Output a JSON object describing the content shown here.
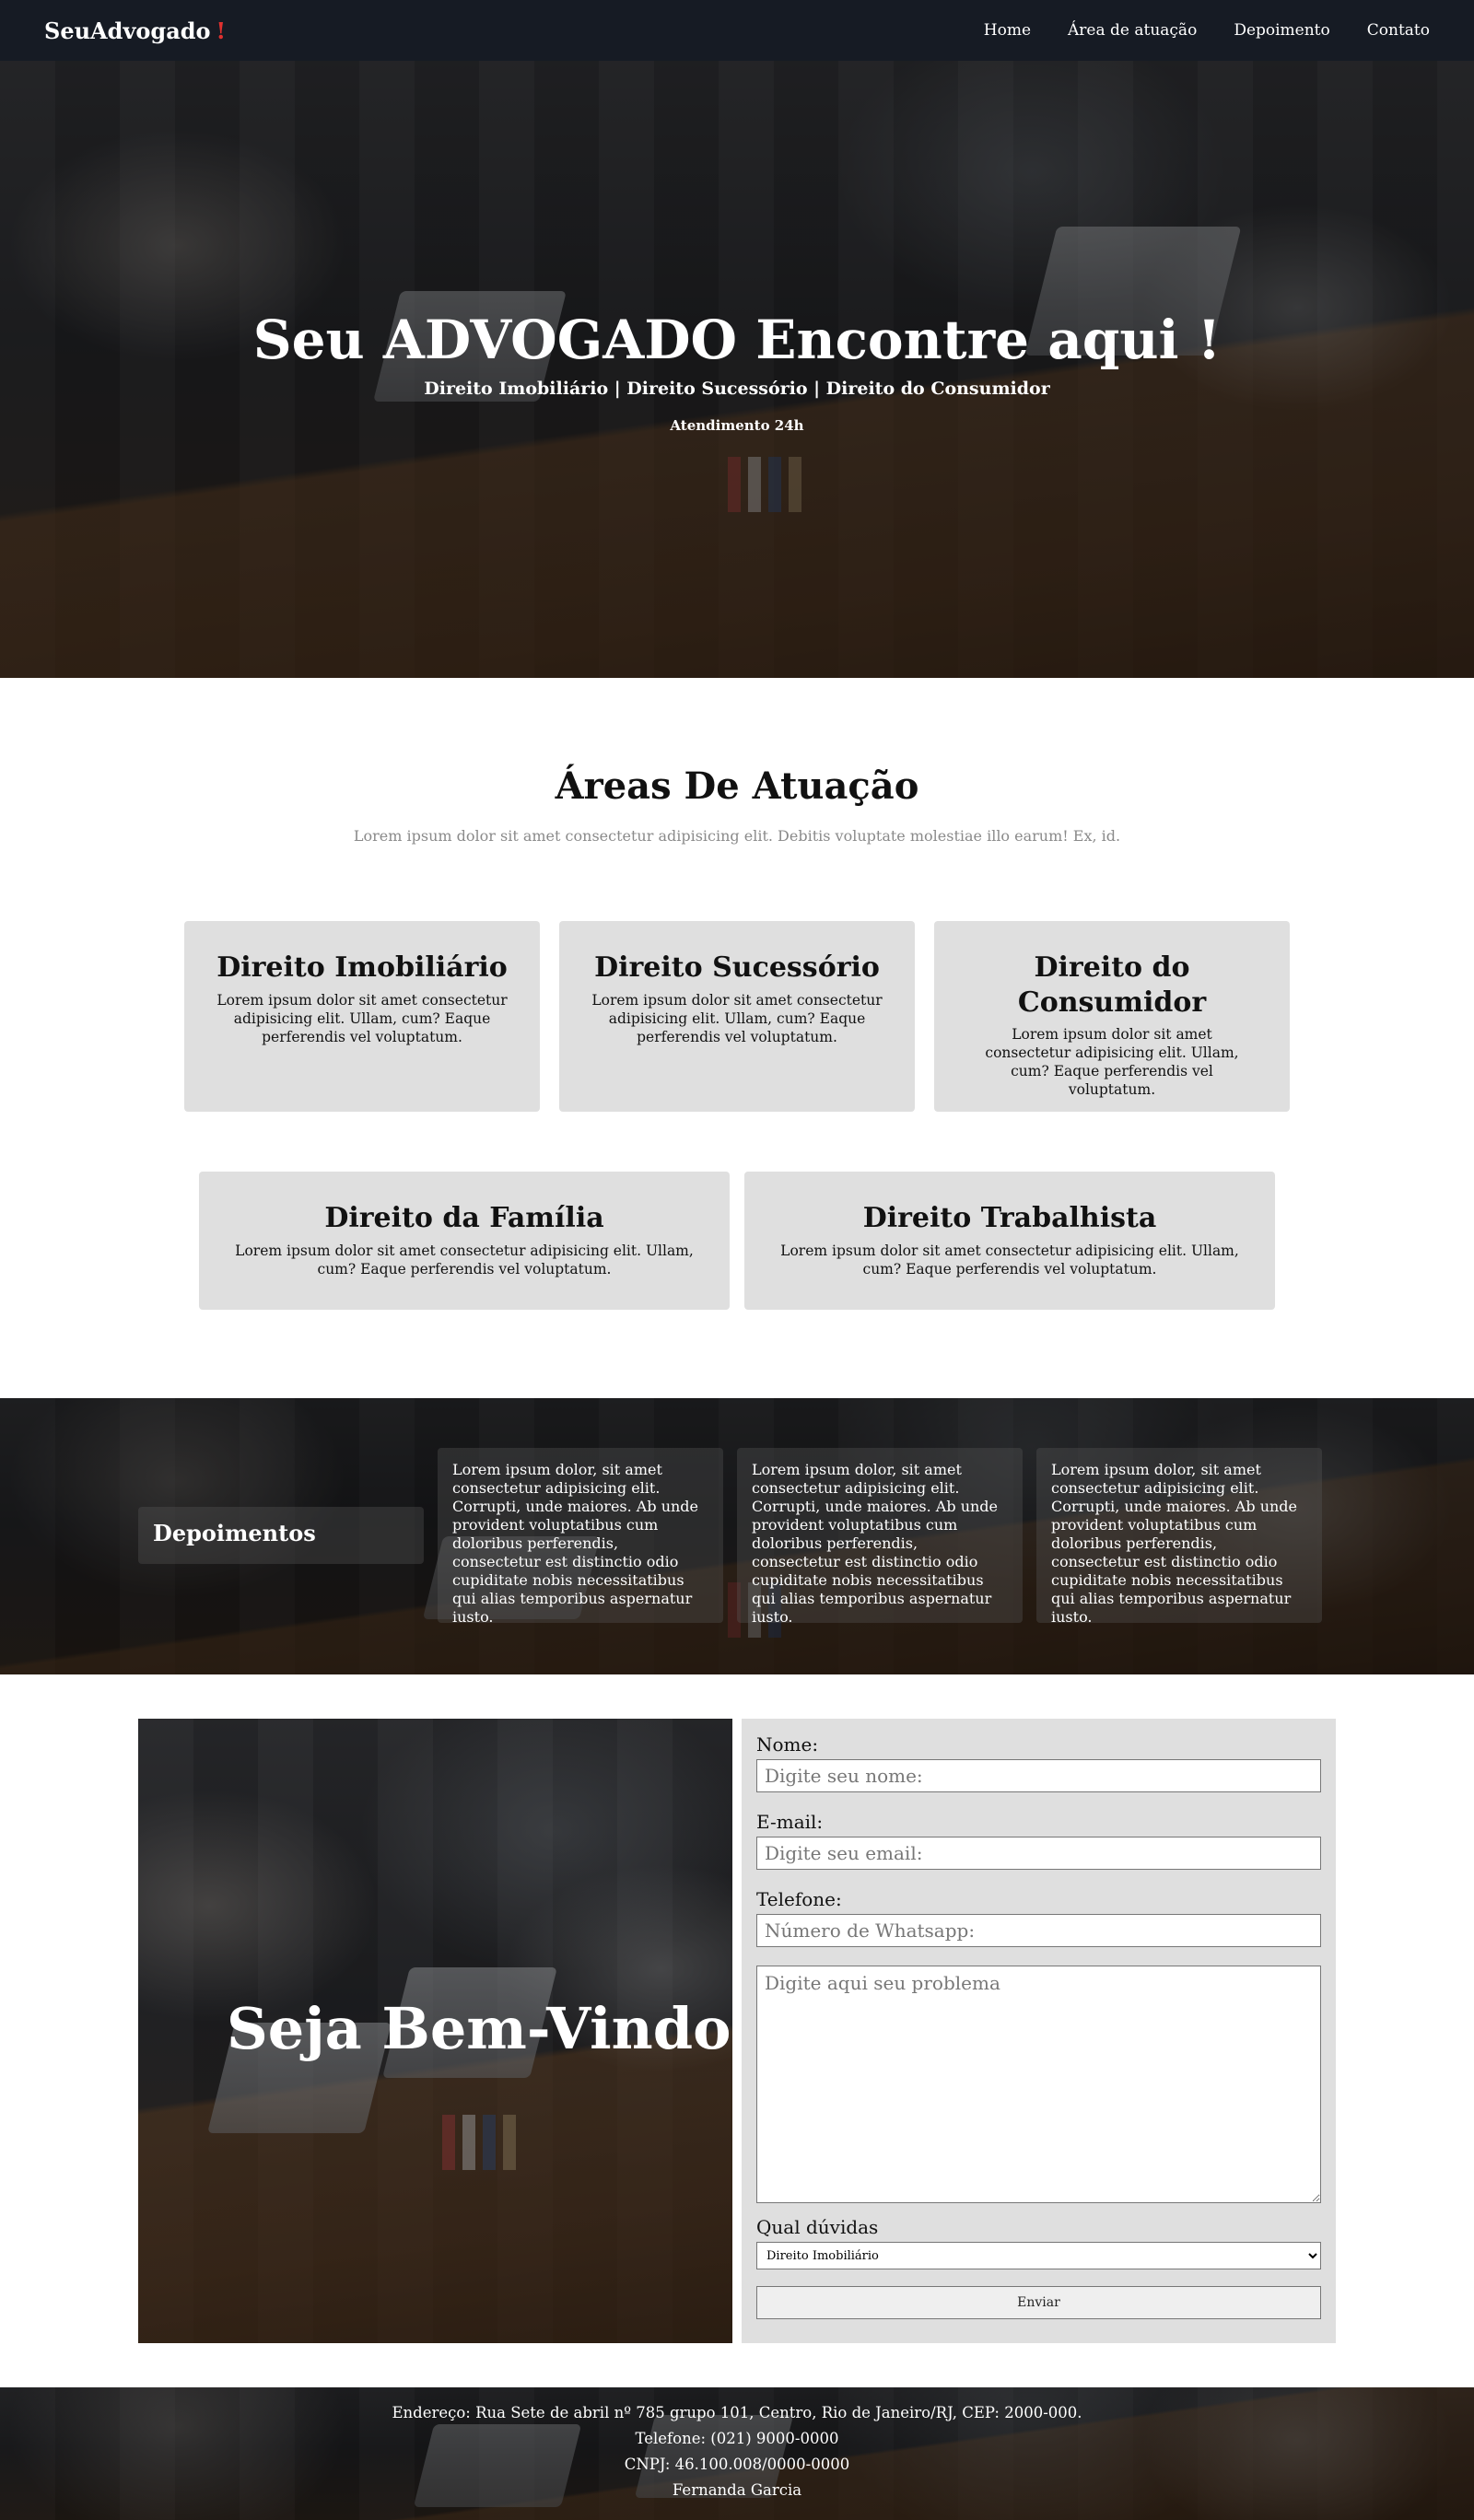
{
  "nav": {
    "brand": "SeuAdvogado",
    "brand_mark": "!",
    "links": [
      "Home",
      "Área de atuação",
      "Depoimento",
      "Contato"
    ]
  },
  "hero": {
    "title": "Seu ADVOGADO Encontre aqui !",
    "subtitle": "Direito Imobiliário | Direito Sucessório | Direito do Consumidor",
    "note": "Atendimento 24h"
  },
  "areas": {
    "title": "Áreas De Atuação",
    "description": "Lorem ipsum dolor sit amet consectetur adipisicing elit. Debitis voluptate molestiae illo earum! Ex, id.",
    "cards": [
      {
        "title": "Direito Imobiliário",
        "text": "Lorem ipsum dolor sit amet consectetur adipisicing elit. Ullam, cum? Eaque perferendis vel voluptatum."
      },
      {
        "title": "Direito Sucessório",
        "text": "Lorem ipsum dolor sit amet consectetur adipisicing elit. Ullam, cum? Eaque perferendis vel voluptatum."
      },
      {
        "title": "Direito do Consumidor",
        "text": "Lorem ipsum dolor sit amet consectetur adipisicing elit. Ullam, cum? Eaque perferendis vel voluptatum."
      },
      {
        "title": "Direito da Família",
        "text": "Lorem ipsum dolor sit amet consectetur adipisicing elit. Ullam, cum? Eaque perferendis vel voluptatum."
      },
      {
        "title": "Direito Trabalhista",
        "text": "Lorem ipsum dolor sit amet consectetur adipisicing elit. Ullam, cum? Eaque perferendis vel voluptatum."
      }
    ]
  },
  "testimonials": {
    "title": "Depoimentos",
    "items": [
      "Lorem ipsum dolor, sit amet consectetur adipisicing elit. Corrupti, unde maiores. Ab unde provident voluptatibus cum doloribus perferendis, consectetur est distinctio odio cupiditate nobis necessitatibus qui alias temporibus aspernatur iusto.",
      "Lorem ipsum dolor, sit amet consectetur adipisicing elit. Corrupti, unde maiores. Ab unde provident voluptatibus cum doloribus perferendis, consectetur est distinctio odio cupiditate nobis necessitatibus qui alias temporibus aspernatur iusto.",
      "Lorem ipsum dolor, sit amet consectetur adipisicing elit. Corrupti, unde maiores. Ab unde provident voluptatibus cum doloribus perferendis, consectetur est distinctio odio cupiditate nobis necessitatibus qui alias temporibus aspernatur iusto."
    ]
  },
  "contact": {
    "welcome": "Seja Bem-Vindo",
    "name_label": "Nome:",
    "name_placeholder": "Digite seu nome:",
    "email_label": "E-mail:",
    "email_placeholder": "Digite seu email:",
    "phone_label": "Telefone:",
    "phone_placeholder": "Número de Whatsapp:",
    "message_placeholder": "Digite aqui seu problema",
    "select_label": "Qual dúvidas",
    "select_value": "Direito Imobiliário",
    "submit_label": "Enviar"
  },
  "footer": {
    "address": "Endereço: Rua Sete de abril nº 785 grupo 101, Centro, Rio de Janeiro/RJ, CEP: 2000-000.",
    "phone": "Telefone: (021) 9000-0000",
    "cnpj": "CNPJ: 46.100.008/0000-0000",
    "name": "Fernanda Garcia"
  },
  "colors": {
    "navbar_bg": "#161b24",
    "brand_accent": "#e0312f",
    "card_bg": "#dfdfdf",
    "muted_text": "#8a8a8a"
  }
}
